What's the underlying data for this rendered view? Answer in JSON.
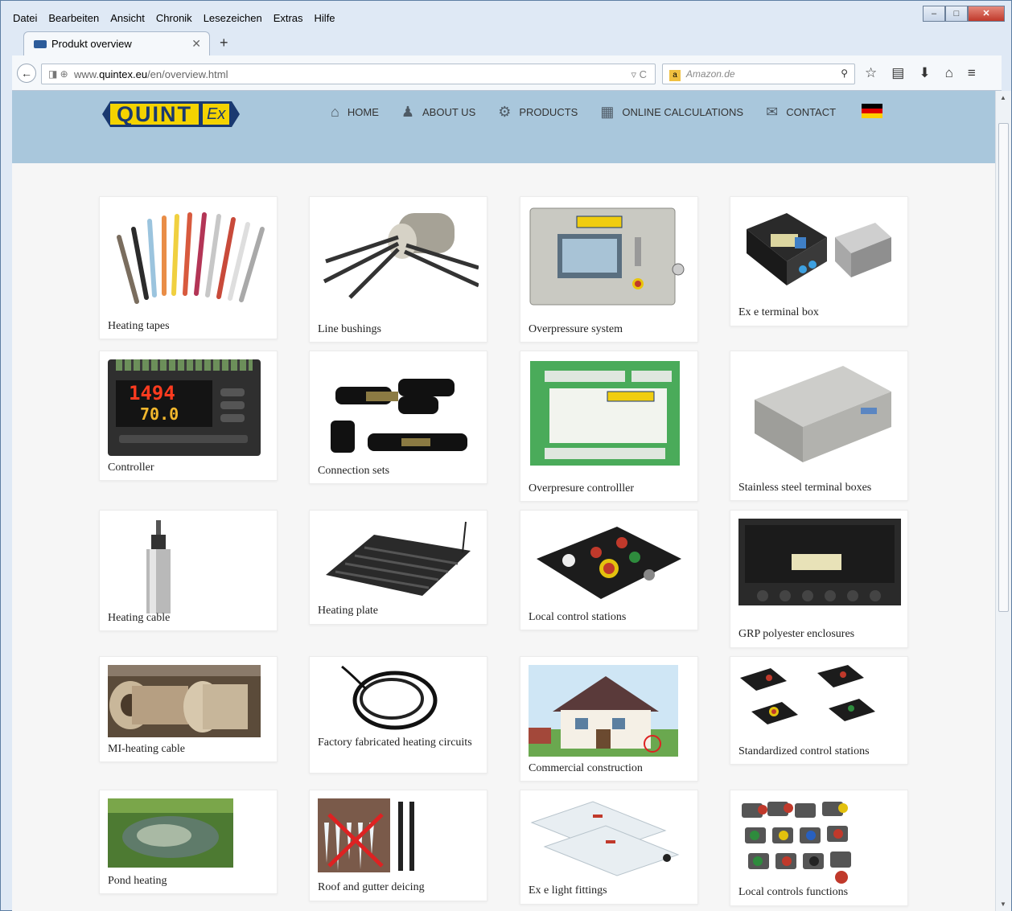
{
  "browser": {
    "menu": [
      "Datei",
      "Bearbeiten",
      "Ansicht",
      "Chronik",
      "Lesezeichen",
      "Extras",
      "Hilfe"
    ],
    "tab_title": "Produkt overview",
    "url_prefix": "www.",
    "url_host": "quintex.eu",
    "url_path": "/en/overview.html",
    "search_placeholder": "Amazon.de"
  },
  "site": {
    "logo_text": "QUINT",
    "logo_ex": "Ex",
    "nav": [
      {
        "label": "HOME",
        "icon": "home-icon"
      },
      {
        "label": "ABOUT US",
        "icon": "person-icon"
      },
      {
        "label": "PRODUCTS",
        "icon": "gears-icon"
      },
      {
        "label": "ONLINE CALCULATIONS",
        "icon": "calculator-icon"
      },
      {
        "label": "CONTACT",
        "icon": "envelope-icon"
      }
    ]
  },
  "products": [
    "Heating tapes",
    "Line bushings",
    "Overpressure system",
    "Ex e terminal box",
    "Controller",
    "Connection sets",
    "Overpresure controlller",
    "Stainless steel terminal boxes",
    "Heating cable",
    "Heating plate",
    "Local control stations",
    "GRP polyester enclosures",
    "MI-heating cable",
    "Factory fabricated heating circuits",
    "Commercial construction",
    "Standardized control stations",
    "Pond heating",
    "Roof and gutter deicing",
    "Ex e light fittings",
    "Local controls functions"
  ],
  "controller_display": {
    "top": "1494",
    "bottom": "70.0"
  },
  "colors": {
    "header_bg": "#a9c7dc",
    "logo_yellow": "#f4d300",
    "logo_blue": "#1a3970",
    "page_bg": "#f6f6f6"
  }
}
